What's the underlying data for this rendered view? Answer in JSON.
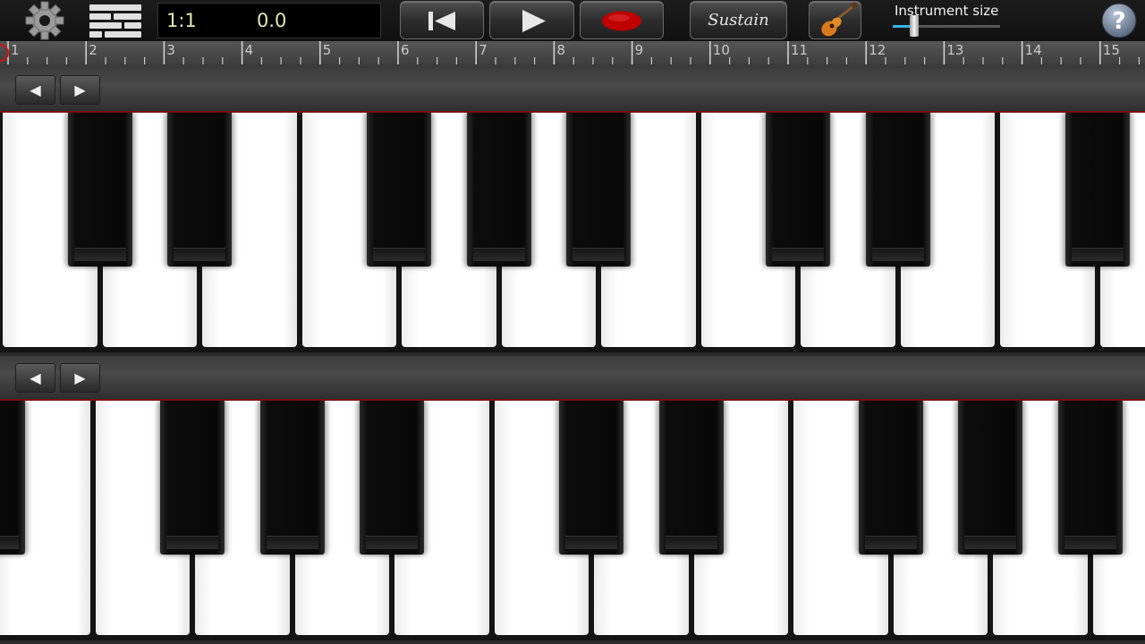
{
  "toolbar": {
    "position": "1:1",
    "time": "0.0",
    "sustain_label": "Sustain",
    "instrument_size_label": "Instrument size",
    "instrument_size_value": 0.2,
    "record_color": "#c00000",
    "accent_color": "#33b5e5"
  },
  "icons": {
    "settings": "gear-icon",
    "menu": "bricks-menu-icon",
    "rewind": "skip-to-start-icon",
    "play": "play-icon",
    "record": "record-icon",
    "instrument": "guitar-icon",
    "help": "question-mark-icon"
  },
  "ruler": {
    "marks": [
      "1",
      "2",
      "3",
      "4",
      "5",
      "6",
      "7",
      "8",
      "9",
      "10",
      "11",
      "12",
      "13",
      "14",
      "15"
    ]
  },
  "keyboards": [
    {
      "prev_label": "◀",
      "next_label": "▶"
    },
    {
      "prev_label": "◀",
      "next_label": "▶"
    }
  ]
}
